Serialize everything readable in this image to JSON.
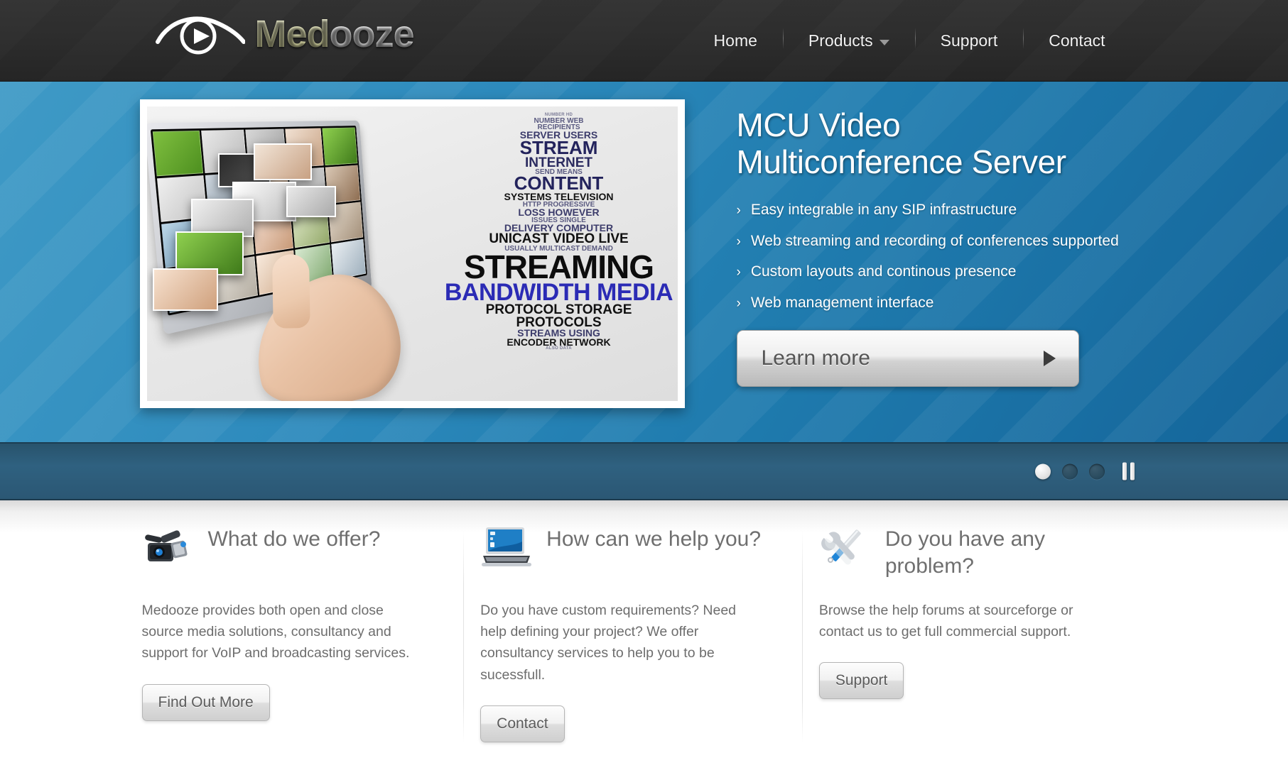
{
  "header": {
    "logo": {
      "icon": "eye-play-icon",
      "text_primary": "Med",
      "text_secondary": "ooze",
      "full_text": "Medooze"
    },
    "nav": [
      {
        "label": "Home",
        "has_dropdown": false
      },
      {
        "label": "Products",
        "has_dropdown": true
      },
      {
        "label": "Support",
        "has_dropdown": false
      },
      {
        "label": "Contact",
        "has_dropdown": false
      }
    ]
  },
  "hero": {
    "title_line1": "MCU Video",
    "title_line2": "Multiconference Server",
    "bullet_marker": "›",
    "bullets": [
      "Easy integrable in any SIP infrastructure",
      "Web streaming and recording of conferences supported",
      "Custom layouts and continous presence",
      "Web management interface"
    ],
    "cta_label": "Learn more",
    "slide_image": {
      "alt": "Touchscreen monitor displaying video thumbnails next to a streaming media word cloud",
      "wordcloud": {
        "r1": "NUMBER  HD",
        "r2": "NUMBER WEB",
        "r3": "RECIPIENTS",
        "r4": "SERVER USERS",
        "r5": "STREAM",
        "r6": "INTERNET",
        "r7": "SEND  MEANS",
        "r8": "CONTENT",
        "r9": "SYSTEMS TELEVISION",
        "r10": "HTTP  PROGRESSIVE",
        "r11": "LOSS HOWEVER",
        "r12": "ISSUES SINGLE",
        "r13": "DELIVERY COMPUTER",
        "r14": "UNICAST VIDEO LIVE",
        "r15": "USUALLY MULTICAST DEMAND",
        "r16": "STREAMING",
        "r17": "BANDWIDTH MEDIA",
        "r18": "PROTOCOL STORAGE",
        "r19": "PROTOCOLS",
        "r20": "STREAMS USING",
        "r21": "ENCODER NETWORK",
        "r22": "ALSO DATA"
      }
    }
  },
  "carousel": {
    "slides_total": 3,
    "active_slide": 1,
    "dots": [
      "slide-1",
      "slide-2",
      "slide-3"
    ],
    "pause_label": "pause"
  },
  "features": {
    "columns": [
      {
        "icon": "video-camera-icon",
        "title": "What do we offer?",
        "text": "Medooze provides both open and close source media solutions, consultancy and support for VoIP and broadcasting services.",
        "button": "Find Out More"
      },
      {
        "icon": "laptop-icon",
        "title": "How can we help you?",
        "text": "Do you have custom requirements? Need help defining your project? We offer consultancy services to help you to be sucessfull.",
        "button": "Contact"
      },
      {
        "icon": "wrench-screwdriver-icon",
        "title": "Do you have any problem?",
        "text": "Browse the help forums at sourceforge or contact us to get full commercial support.",
        "button": "Support"
      }
    ]
  },
  "colors": {
    "header_bg": "#2e2e2e",
    "hero_blue": "#2e8bbd",
    "carousel_bar": "#2f6180",
    "logo_cream": "#efefc0",
    "text_gray": "#6d6d6d"
  }
}
